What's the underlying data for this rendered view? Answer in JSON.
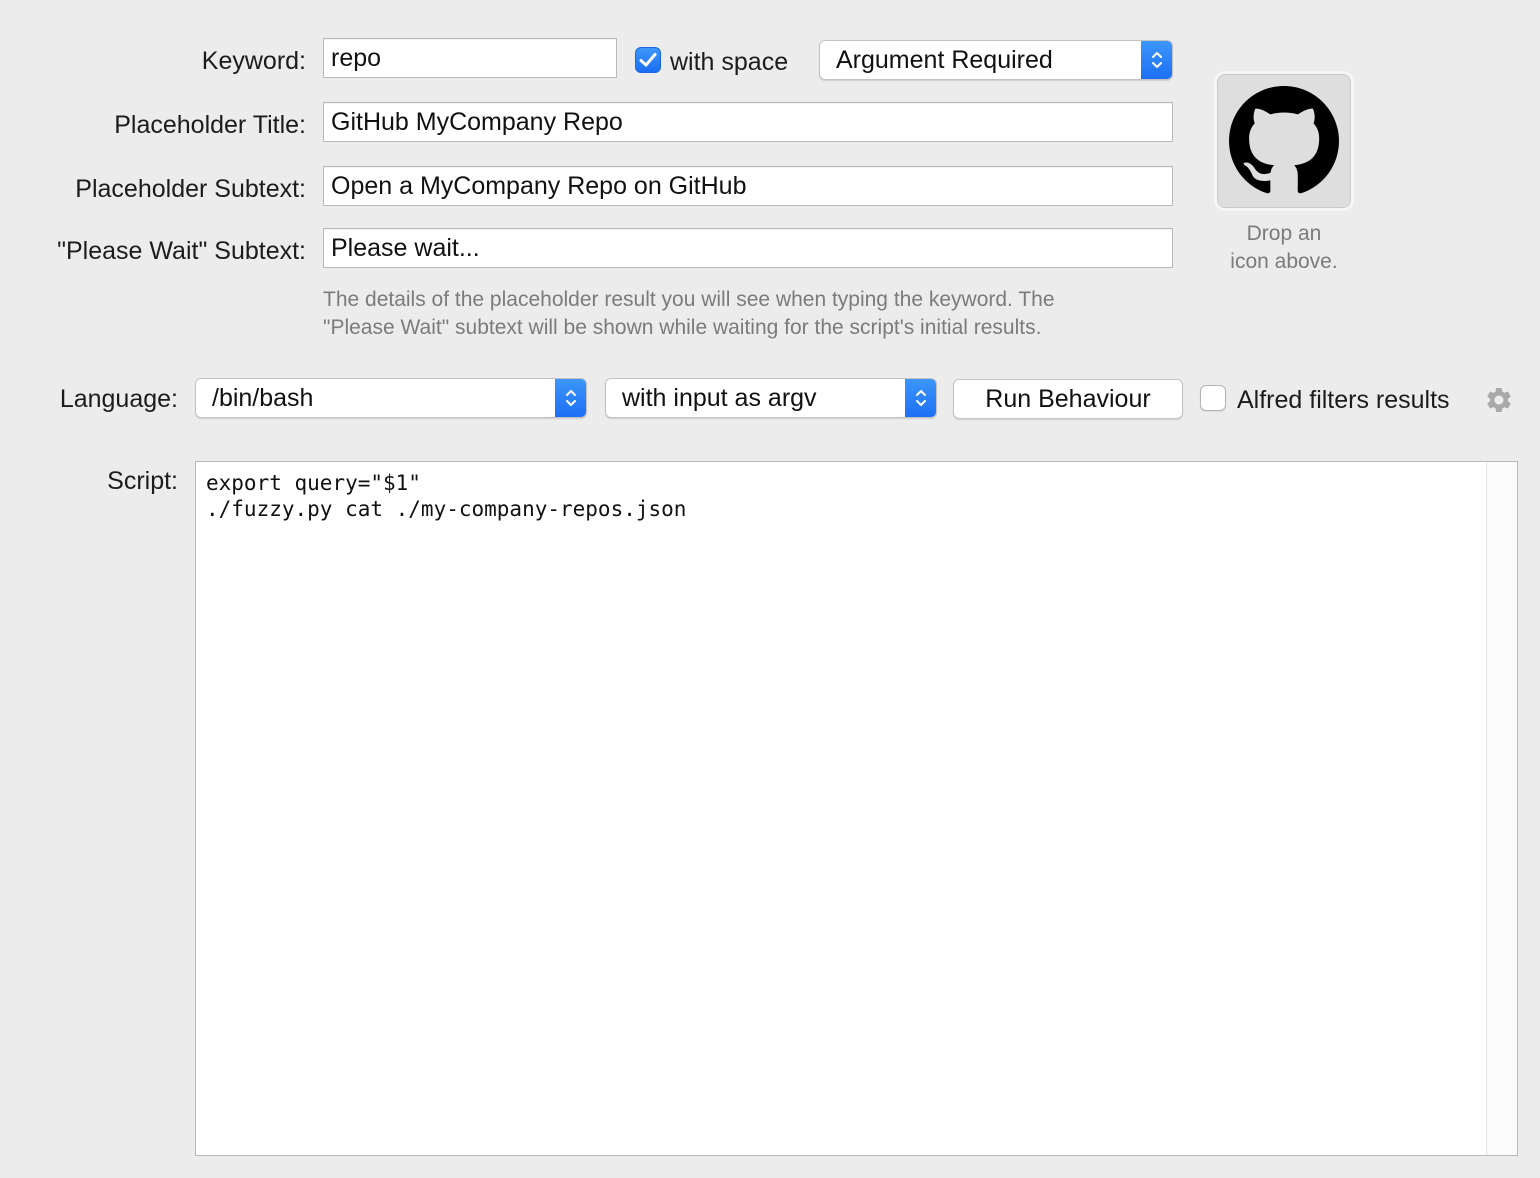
{
  "fields": {
    "keyword": {
      "label": "Keyword:",
      "value": "repo"
    },
    "with_space": {
      "label": "with space",
      "checked": true
    },
    "argument_mode": {
      "value": "Argument Required"
    },
    "placeholder_title": {
      "label": "Placeholder Title:",
      "value": "GitHub MyCompany Repo"
    },
    "placeholder_subtext": {
      "label": "Placeholder Subtext:",
      "value": "Open a MyCompany Repo on GitHub"
    },
    "please_wait_subtext": {
      "label": "\"Please Wait\" Subtext:",
      "value": "Please wait..."
    }
  },
  "hint": {
    "line1": "The details of the placeholder result you will see when typing the keyword. The",
    "line2": "\"Please Wait\" subtext will be shown while waiting for the script's initial results."
  },
  "icon_well": {
    "icon": "github-logo",
    "caption_line1": "Drop an",
    "caption_line2": "icon above."
  },
  "language": {
    "label": "Language:",
    "value": "/bin/bash",
    "input_mode": "with input as argv",
    "run_behaviour_label": "Run Behaviour",
    "alfred_filters": {
      "label": "Alfred filters results",
      "checked": false
    },
    "settings_icon": "gear-icon"
  },
  "script": {
    "label": "Script:",
    "code": "export query=\"$1\"\n./fuzzy.py cat ./my-company-repos.json"
  },
  "colors": {
    "background": "#ececec",
    "accent": "#1b6ef3",
    "hint_text": "#7b7b7b"
  }
}
